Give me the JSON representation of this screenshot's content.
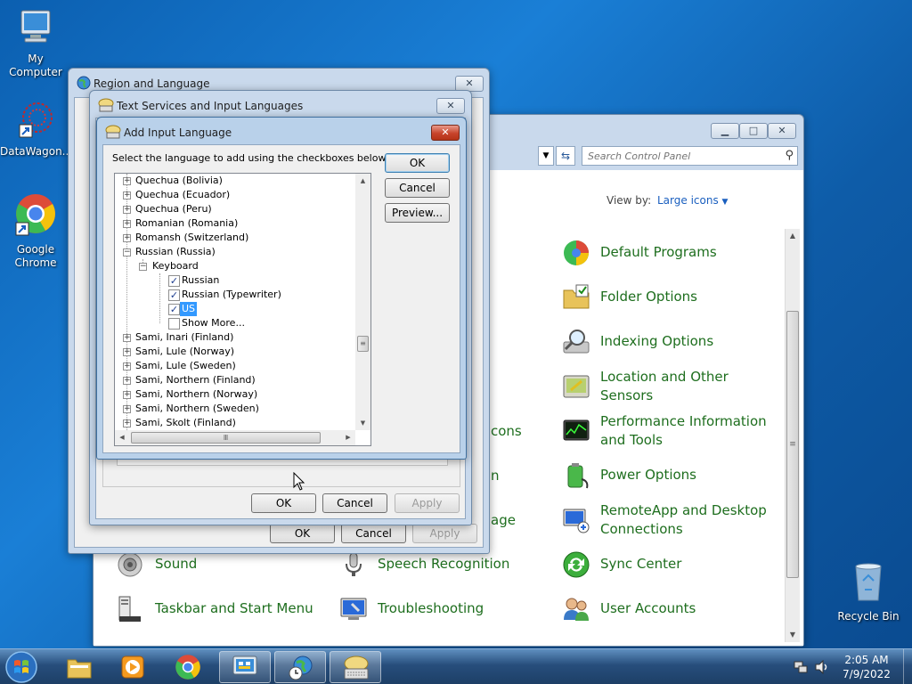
{
  "desktop": {
    "icons": [
      {
        "label": "My Computer"
      },
      {
        "label": "DataWagon..."
      },
      {
        "label": "Google Chrome"
      },
      {
        "label": "Recycle Bin"
      }
    ]
  },
  "control_panel": {
    "search_placeholder": "Search Control Panel",
    "view_by_label": "View by:",
    "view_by_value": "Large icons",
    "partial_items": [
      "cons",
      "n",
      "age"
    ],
    "items": [
      {
        "label": "Default Programs",
        "icon": "default-programs-icon"
      },
      {
        "label": "Folder Options",
        "icon": "folder-options-icon"
      },
      {
        "label": "Indexing Options",
        "icon": "indexing-options-icon"
      },
      {
        "label": "Location and Other Sensors",
        "icon": "location-sensors-icon"
      },
      {
        "label": "Performance Information and Tools",
        "icon": "performance-icon"
      },
      {
        "label": "Power Options",
        "icon": "power-options-icon"
      },
      {
        "label": "RemoteApp and Desktop Connections",
        "icon": "remoteapp-icon"
      },
      {
        "label": "Sound",
        "icon": "sound-icon"
      },
      {
        "label": "Speech Recognition",
        "icon": "speech-recognition-icon"
      },
      {
        "label": "Sync Center",
        "icon": "sync-center-icon"
      },
      {
        "label": "Taskbar and Start Menu",
        "icon": "taskbar-icon"
      },
      {
        "label": "Troubleshooting",
        "icon": "troubleshooting-icon"
      },
      {
        "label": "User Accounts",
        "icon": "user-accounts-icon"
      }
    ]
  },
  "region_dialog": {
    "title": "Region and Language",
    "ok": "OK",
    "cancel": "Cancel",
    "apply": "Apply"
  },
  "text_services_dialog": {
    "title": "Text Services and Input Languages",
    "ok": "OK",
    "cancel": "Cancel",
    "apply": "Apply"
  },
  "add_input_dialog": {
    "title": "Add Input Language",
    "instruction": "Select the language to add using the checkboxes below.",
    "ok": "OK",
    "cancel": "Cancel",
    "preview": "Preview...",
    "tree": {
      "before": [
        "Quechua (Bolivia)",
        "Quechua (Ecuador)",
        "Quechua (Peru)",
        "Romanian (Romania)",
        "Romansh (Switzerland)"
      ],
      "expanded": "Russian (Russia)",
      "keyboard": "Keyboard",
      "layouts": [
        {
          "label": "Russian",
          "checked": true
        },
        {
          "label": "Russian (Typewriter)",
          "checked": true
        },
        {
          "label": "US",
          "checked": true,
          "selected": true
        },
        {
          "label": "Show More...",
          "checked": false
        }
      ],
      "after": [
        "Sami, Inari (Finland)",
        "Sami, Lule (Norway)",
        "Sami, Lule (Sweden)",
        "Sami, Northern (Finland)",
        "Sami, Northern (Norway)",
        "Sami, Northern (Sweden)",
        "Sami, Skolt (Finland)"
      ]
    }
  },
  "taskbar": {
    "time": "2:05 AM",
    "date": "7/9/2022"
  }
}
